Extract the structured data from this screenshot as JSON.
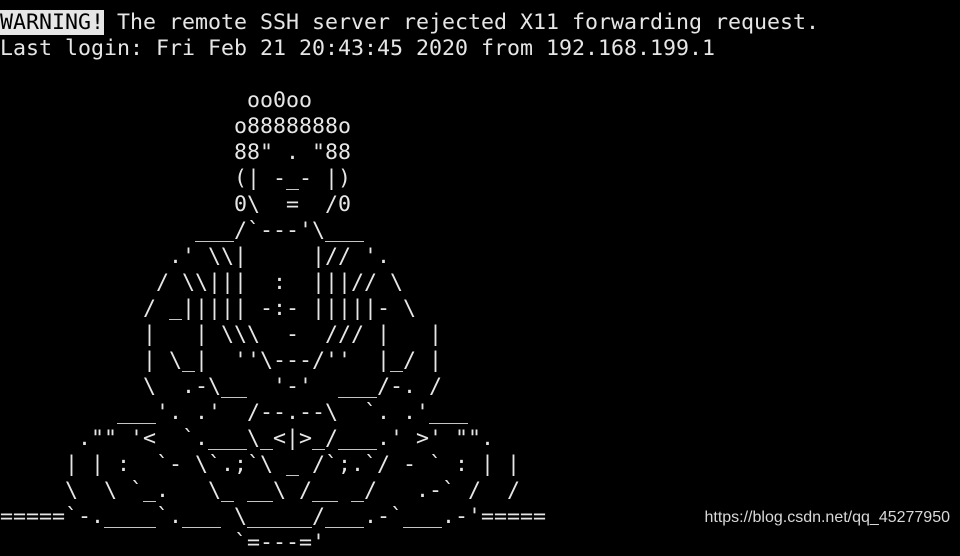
{
  "terminal": {
    "warning_tag": "WARNING!",
    "warning_message": " The remote SSH server rejected X11 forwarding request.",
    "last_login": "Last login: Fri Feb 21 20:43:45 2020 from 192.168.199.1",
    "banner_lines": [
      "                   oo0oo",
      "                  o8888888o",
      "                  88\" . \"88",
      "                  (| -_- |)",
      "                  0\\  =  /0",
      "               ___/`---'\\___",
      "             .' \\\\|     |// '.",
      "            / \\\\|||  :  |||// \\",
      "           / _||||| -:- |||||- \\",
      "           |   | \\\\\\  -  /// |   |",
      "           | \\_|  ''\\---/''  |_/ |",
      "           \\  .-\\__  '-'  ___/-. /",
      "         ___'. .'  /--.--\\  `. .'___",
      "      .\"\" '<  `.___\\_<|>_/___.' >' \"\".",
      "     | | :  `- \\`.;`\\ _ /`;.`/ - ` : | |",
      "     \\  \\ `_.   \\_ __\\ /__ _/   .-` /  /",
      "=====`-.____`.___ \\_____/___.-`___.-'=====",
      "                  `=---='"
    ]
  },
  "colors": {
    "background": "#000000",
    "foreground": "#e6e6e6",
    "warning_highlight": "#e6e6e6"
  },
  "watermark": {
    "text": "https://blog.csdn.net/qq_45277950"
  }
}
